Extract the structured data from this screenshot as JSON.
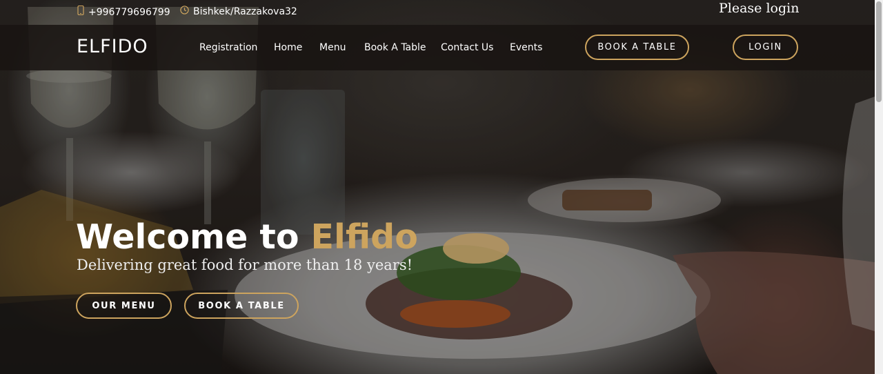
{
  "topbar": {
    "phone_icon": "mobile-phone-icon",
    "phone": "+996779696799",
    "location_icon": "clock-icon",
    "location": "Bishkek/Razzakova32",
    "login_prompt": "Please login"
  },
  "navbar": {
    "logo": "ELFIDO",
    "links": [
      "Registration",
      "Home",
      "Menu",
      "Book A Table",
      "Contact Us",
      "Events"
    ],
    "book_button": "BOOK A TABLE",
    "login_button": "LOGIN"
  },
  "hero": {
    "title_prefix": "Welcome to ",
    "title_accent": "Elfido",
    "subtitle": "Delivering great food for more than 18 years!",
    "menu_button": "OUR MENU",
    "book_button": "BOOK A TABLE"
  },
  "colors": {
    "accent": "#cda45e",
    "navbar_bg": "#181412",
    "text": "#ffffff"
  }
}
